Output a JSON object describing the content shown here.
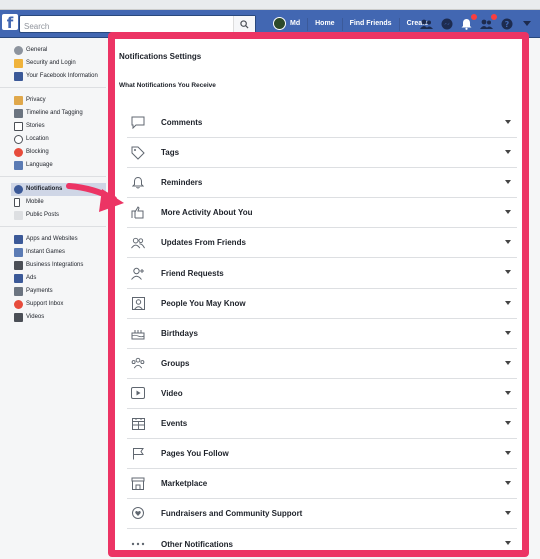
{
  "topnav": {
    "search_placeholder": "Search",
    "user_name": "Md",
    "home": "Home",
    "find_friends": "Find Friends",
    "create": "Create"
  },
  "sidebar": {
    "group1": [
      "General",
      "Security and Login",
      "Your Facebook Information"
    ],
    "group2": [
      "Privacy",
      "Timeline and Tagging",
      "Stories",
      "Location",
      "Blocking",
      "Language"
    ],
    "group3": [
      "Notifications",
      "Mobile",
      "Public Posts"
    ],
    "group4": [
      "Apps and Websites",
      "Instant Games",
      "Business Integrations",
      "Ads",
      "Payments",
      "Support Inbox",
      "Videos"
    ]
  },
  "panel": {
    "title": "Notifications Settings",
    "subtitle": "What Notifications You Receive",
    "rows": [
      {
        "label": "Comments",
        "icon": "comment-icon"
      },
      {
        "label": "Tags",
        "icon": "tag-icon"
      },
      {
        "label": "Reminders",
        "icon": "bell-icon"
      },
      {
        "label": "More Activity About You",
        "icon": "activity-icon"
      },
      {
        "label": "Updates From Friends",
        "icon": "friends-icon"
      },
      {
        "label": "Friend Requests",
        "icon": "add-friend-icon"
      },
      {
        "label": "People You May Know",
        "icon": "person-frame-icon"
      },
      {
        "label": "Birthdays",
        "icon": "cake-icon"
      },
      {
        "label": "Groups",
        "icon": "groups-icon"
      },
      {
        "label": "Video",
        "icon": "video-icon"
      },
      {
        "label": "Events",
        "icon": "calendar-icon"
      },
      {
        "label": "Pages You Follow",
        "icon": "flag-icon"
      },
      {
        "label": "Marketplace",
        "icon": "shop-icon"
      },
      {
        "label": "Fundraisers and Community Support",
        "icon": "heart-hand-icon"
      },
      {
        "label": "Other Notifications",
        "icon": "more-icon"
      }
    ]
  },
  "colors": {
    "brand": "#4267b2",
    "highlight_border": "#ec3464",
    "active_item": "#cfd6e6"
  }
}
